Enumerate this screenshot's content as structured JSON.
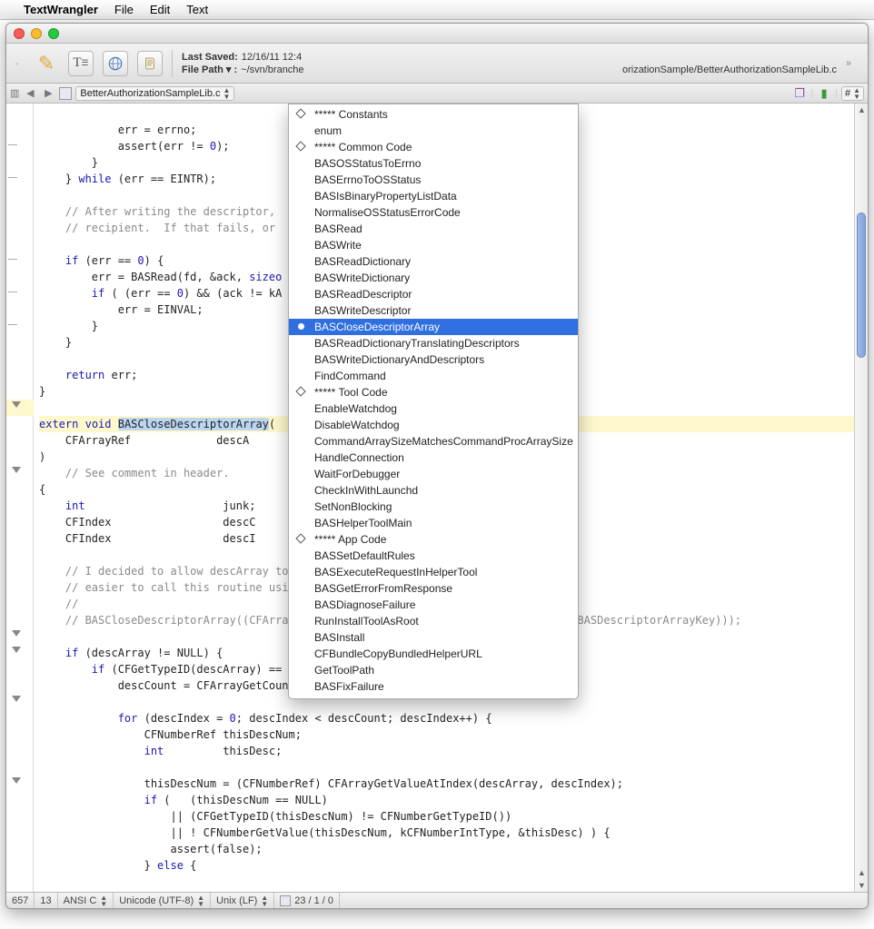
{
  "menubar": {
    "apple": "",
    "app": "TextWrangler",
    "items": [
      "File",
      "Edit",
      "Text"
    ]
  },
  "toolbar": {
    "last_saved_label": "Last Saved:",
    "last_saved_value": "12/16/11 12:4",
    "file_path_label": "File Path ▾ :",
    "file_path_value_prefix": "~/svn/branche",
    "file_path_value_suffix": "orizationSample/BetterAuthorizationSampleLib.c"
  },
  "tabbar": {
    "doc_name": "BetterAuthorizationSampleLib.c",
    "hash_label": "#",
    "book_icon": "book-icon",
    "flag_icon": "flag-icon"
  },
  "popup": {
    "items": [
      {
        "label": "***** Constants",
        "kind": "header"
      },
      {
        "label": "enum",
        "kind": "fn"
      },
      {
        "label": "***** Common Code",
        "kind": "header"
      },
      {
        "label": "BASOSStatusToErrno",
        "kind": "fn"
      },
      {
        "label": "BASErrnoToOSStatus",
        "kind": "fn"
      },
      {
        "label": "BASIsBinaryPropertyListData",
        "kind": "fn"
      },
      {
        "label": "NormaliseOSStatusErrorCode",
        "kind": "fn"
      },
      {
        "label": "BASRead",
        "kind": "fn"
      },
      {
        "label": "BASWrite",
        "kind": "fn"
      },
      {
        "label": "BASReadDictionary",
        "kind": "fn"
      },
      {
        "label": "BASWriteDictionary",
        "kind": "fn"
      },
      {
        "label": "BASReadDescriptor",
        "kind": "fn"
      },
      {
        "label": "BASWriteDescriptor",
        "kind": "fn"
      },
      {
        "label": "BASCloseDescriptorArray",
        "kind": "fn",
        "selected": true
      },
      {
        "label": "BASReadDictionaryTranslatingDescriptors",
        "kind": "fn"
      },
      {
        "label": "BASWriteDictionaryAndDescriptors",
        "kind": "fn"
      },
      {
        "label": "FindCommand",
        "kind": "fn"
      },
      {
        "label": "***** Tool Code",
        "kind": "header"
      },
      {
        "label": "EnableWatchdog",
        "kind": "fn"
      },
      {
        "label": "DisableWatchdog",
        "kind": "fn"
      },
      {
        "label": "CommandArraySizeMatchesCommandProcArraySize",
        "kind": "fn"
      },
      {
        "label": "HandleConnection",
        "kind": "fn"
      },
      {
        "label": "WaitForDebugger",
        "kind": "fn"
      },
      {
        "label": "CheckInWithLaunchd",
        "kind": "fn"
      },
      {
        "label": "SetNonBlocking",
        "kind": "fn"
      },
      {
        "label": "BASHelperToolMain",
        "kind": "fn"
      },
      {
        "label": "***** App Code",
        "kind": "header"
      },
      {
        "label": "BASSetDefaultRules",
        "kind": "fn"
      },
      {
        "label": "BASExecuteRequestInHelperTool",
        "kind": "fn"
      },
      {
        "label": "BASGetErrorFromResponse",
        "kind": "fn"
      },
      {
        "label": "BASDiagnoseFailure",
        "kind": "fn"
      },
      {
        "label": "RunInstallToolAsRoot",
        "kind": "fn"
      },
      {
        "label": "BASInstall",
        "kind": "fn"
      },
      {
        "label": "CFBundleCopyBundledHelperURL",
        "kind": "fn"
      },
      {
        "label": "GetToolPath",
        "kind": "fn"
      },
      {
        "label": "BASFixFailure",
        "kind": "fn"
      }
    ]
  },
  "code": {
    "l1": "            err = errno;",
    "l2": "            assert(err != ",
    "l2n": "0",
    "l2e": ");",
    "l3": "        }",
    "l4": "    } ",
    "l4k": "while",
    "l4e": " (err == EINTR);",
    "l6a": "    // After writing the descriptor, ",
    "l7a": "    // recipient.  If that fails, or ",
    "l9a": "    ",
    "l9k": "if",
    "l9b": " (err == ",
    "l9n": "0",
    "l9c": ") {",
    "l10a": "        err = BASRead(fd, &ack, ",
    "l10k": "sizeo",
    "l11a": "        ",
    "l11k": "if",
    "l11b": " ( (err == ",
    "l11n": "0",
    "l11c": ") && (ack != kA",
    "l12": "            err = EINVAL;",
    "l13": "        }",
    "l14": "    }",
    "l16a": "    ",
    "l16k": "return",
    "l16b": " err;",
    "l17": "}",
    "l19a": "extern",
    "l19b": " ",
    "l19c": "void",
    "l19d": " ",
    "l19sel": "BASCloseDescriptorArray",
    "l19e": "(",
    "l20": "    CFArrayRef             descA",
    "l21": ")",
    "l22": "    // See comment in header.",
    "l23": "{",
    "l24a": "    ",
    "l24k": "int",
    "l24b": "                     junk;",
    "l25": "    CFIndex                 descC",
    "l26": "    CFIndex                 descI",
    "l28": "    // I decided to allow descArray to be NULL because it makes it",
    "l29": "    // easier to call this routine using the code.",
    "l30": "    //",
    "l31": "    // BASCloseDescriptorArray((CFArrayRef) CFDictionaryGetValue(response, CFSTR(kBASDescriptorArrayKey)));",
    "l33a": "    ",
    "l33k": "if",
    "l33b": " (descArray != NULL) {",
    "l34a": "        ",
    "l34k": "if",
    "l34b": " (CFGetTypeID(descArray) == CFArrayGetTypeID()) {",
    "l35": "            descCount = CFArrayGetCount(descArray);",
    "l37a": "            ",
    "l37k": "for",
    "l37b": " (descIndex = ",
    "l37n": "0",
    "l37c": "; descIndex < descCount; descIndex++) {",
    "l38": "                CFNumberRef thisDescNum;",
    "l39a": "                ",
    "l39k": "int",
    "l39b": "         thisDesc;",
    "l41": "                thisDescNum = (CFNumberRef) CFArrayGetValueAtIndex(descArray, descIndex);",
    "l42a": "                ",
    "l42k": "if",
    "l42b": " (   (thisDescNum == NULL)",
    "l43": "                    || (CFGetTypeID(thisDescNum) != CFNumberGetTypeID())",
    "l44": "                    || ! CFNumberGetValue(thisDescNum, kCFNumberIntType, &thisDesc) ) {",
    "l45": "                    assert(false);",
    "l46a": "                } ",
    "l46k": "else",
    "l46b": " {"
  },
  "statusbar": {
    "line": "657",
    "col": "13",
    "lang": "ANSI C",
    "enc": "Unicode (UTF-8)",
    "lineend": "Unix (LF)",
    "sel": "23 / 1 / 0"
  }
}
